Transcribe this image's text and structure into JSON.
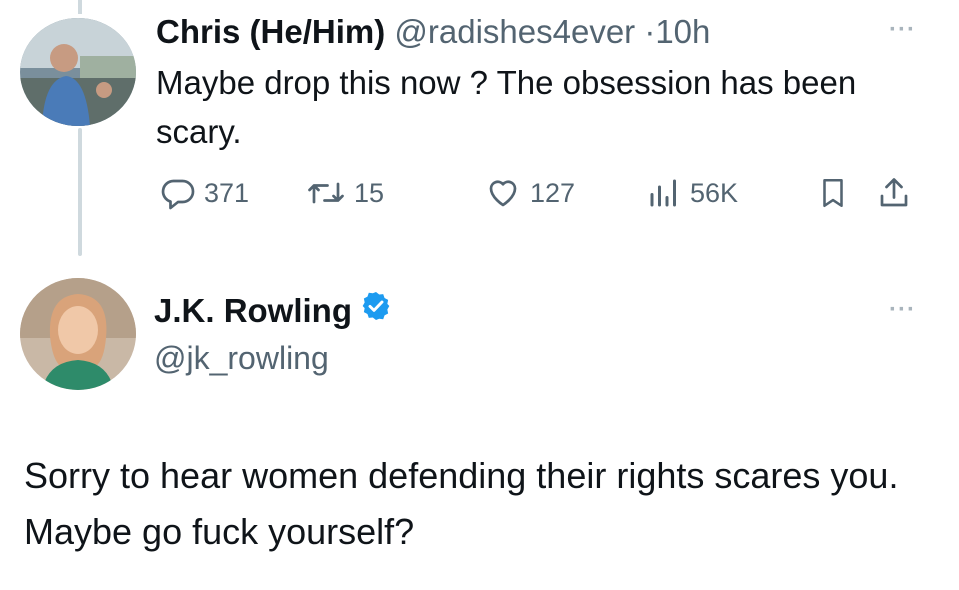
{
  "tweet1": {
    "display_name": "Chris (He/Him)",
    "handle": "@radishes4ever",
    "separator": "·",
    "time": "10h",
    "text": "Maybe drop this now ? The obsession has been scary.",
    "actions": {
      "replies": "371",
      "retweets": "15",
      "likes": "127",
      "views": "56K"
    },
    "icons": [
      "reply-icon",
      "retweet-icon",
      "like-icon",
      "views-icon",
      "bookmark-icon",
      "share-icon",
      "more-icon"
    ]
  },
  "tweet2": {
    "display_name": "J.K. Rowling",
    "handle": "@jk_rowling",
    "verified": true,
    "text": "Sorry to hear women defending their rights scares you. Maybe go fuck yourself?"
  },
  "colors": {
    "text_primary": "#0f1419",
    "text_secondary": "#536471",
    "verified_blue": "#1d9bf0",
    "thread_line": "#cfd9de"
  }
}
